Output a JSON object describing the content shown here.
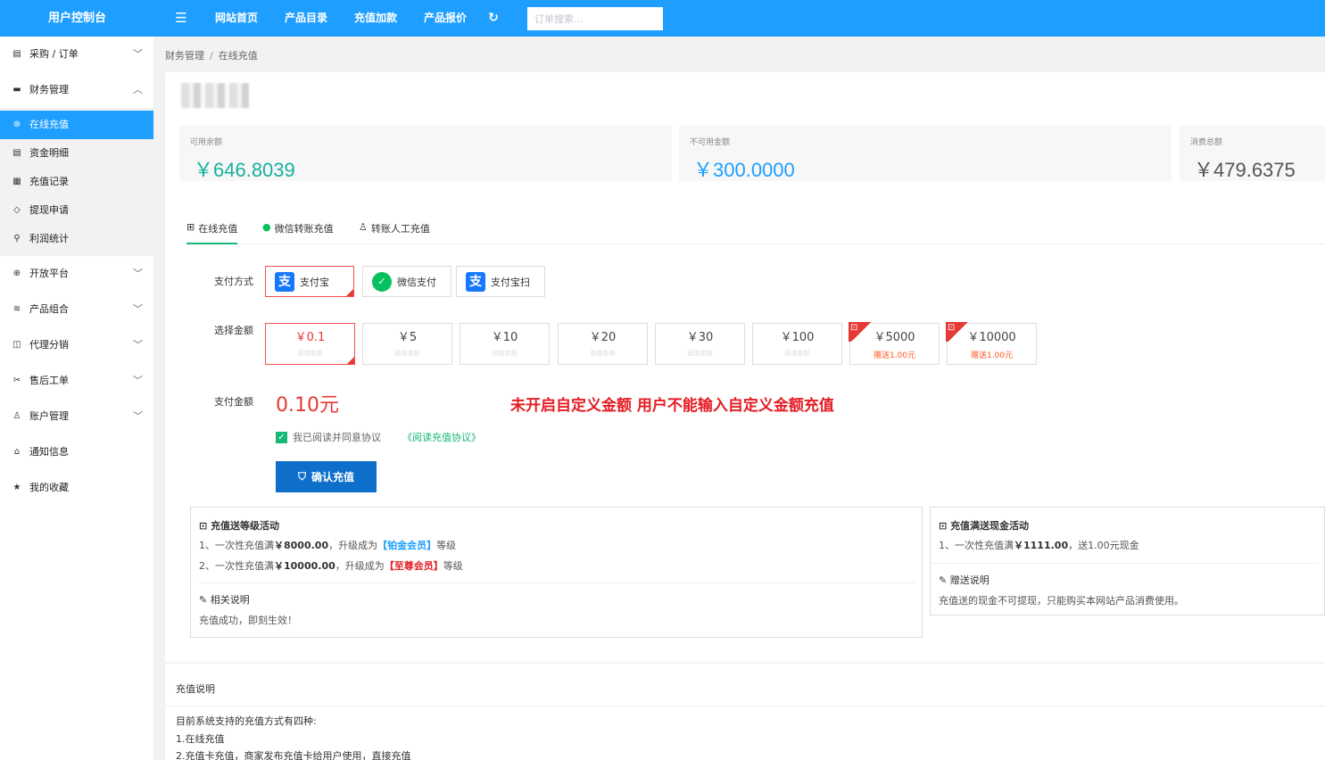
{
  "header": {
    "brand": "用户控制台",
    "menu_icon": "menu-icon",
    "nav": [
      "网站首页",
      "产品目录",
      "充值加款",
      "产品报价"
    ],
    "refresh_icon": "refresh-icon",
    "search_placeholder": "订单搜索..."
  },
  "sidebar": {
    "items": [
      {
        "label": "采购 / 订单",
        "icon": "order-icon",
        "chevron": "down"
      },
      {
        "label": "财务管理",
        "icon": "finance-icon",
        "chevron": "up"
      },
      {
        "label": "开放平台",
        "icon": "globe-icon",
        "chevron": "down"
      },
      {
        "label": "产品组合",
        "icon": "layers-icon",
        "chevron": "down"
      },
      {
        "label": "代理分销",
        "icon": "agent-icon",
        "chevron": "down"
      },
      {
        "label": "售后工单",
        "icon": "tools-icon",
        "chevron": "down"
      },
      {
        "label": "账户管理",
        "icon": "user-icon",
        "chevron": "down"
      },
      {
        "label": "通知信息",
        "icon": "home-icon",
        "chevron": ""
      },
      {
        "label": "我的收藏",
        "icon": "star-icon",
        "chevron": ""
      }
    ],
    "finance_sub": [
      {
        "label": "在线充值",
        "icon": "yen-icon",
        "active": true
      },
      {
        "label": "资金明细",
        "icon": "file-icon"
      },
      {
        "label": "充值记录",
        "icon": "calendar-icon"
      },
      {
        "label": "提现申请",
        "icon": "tag-icon"
      },
      {
        "label": "利润统计",
        "icon": "search-icon"
      }
    ]
  },
  "breadcrumb": {
    "parent": "财务管理",
    "sep": "/",
    "current": "在线充值"
  },
  "balance": {
    "available_label": "可用余额",
    "available_value": "￥646.8039",
    "unavailable_label": "不可用金额",
    "unavailable_value": "￥300.0000",
    "total_label": "消费总额",
    "total_value": "￥479.6375",
    "colors": {
      "available": "#16b0a0",
      "unavailable": "#1e9fff",
      "total": "#555555"
    }
  },
  "tabs": [
    {
      "label": "在线充值",
      "icon": "windows-icon"
    },
    {
      "label": "微信转账充值",
      "icon": "wechat-icon"
    },
    {
      "label": "转账人工充值",
      "icon": "person-icon"
    }
  ],
  "pay_method": {
    "label": "支付方式",
    "options": [
      {
        "label": "支付宝",
        "logo": "支"
      },
      {
        "label": "微信支付",
        "logo": "✓"
      },
      {
        "label": "支付宝扫",
        "logo": "支"
      }
    ]
  },
  "amount": {
    "label": "选择金额",
    "options": [
      {
        "value": "￥0.1",
        "sub": "面值金额"
      },
      {
        "value": "￥5",
        "sub": "面值金额"
      },
      {
        "value": "￥10",
        "sub": "面值金额"
      },
      {
        "value": "￥20",
        "sub": "面值金额"
      },
      {
        "value": "￥30",
        "sub": "面值金额"
      },
      {
        "value": "￥100",
        "sub": "面值金额"
      },
      {
        "value": "￥5000",
        "sub": "赠送1.00元"
      },
      {
        "value": "￥10000",
        "sub": "赠送1.00元"
      }
    ],
    "gift_icon": "gift-icon"
  },
  "payment": {
    "label": "支付金额",
    "value": "0.10元",
    "notice": "未开启自定义金额 用户不能输入自定义金额充值"
  },
  "agreement": {
    "text": "我已阅读并同意协议",
    "link": "《阅读充值协议》",
    "checked": true
  },
  "confirm_button": "确认充值",
  "promo_level": {
    "title": "充值送等级活动",
    "line1_pre": "1、一次性充值满",
    "line1_amount": "￥8000.00",
    "line1_mid": "，升级成为",
    "line1_level": "【铂金会员】",
    "line1_post": "等级",
    "line2_pre": "2、一次性充值满",
    "line2_amount": "￥10000.00",
    "line2_mid": "，升级成为",
    "line2_level": "【至尊会员】",
    "line2_post": "等级",
    "note_title": "相关说明",
    "note_text": "充值成功，即刻生效！"
  },
  "promo_cash": {
    "title": "充值满送现金活动",
    "line1_pre": "1、一次性充值满",
    "line1_amount": "￥1111.00",
    "line1_post": "，送1.00元现金",
    "note_title": "赠送说明",
    "note_text": "充值送的现金不可提现，只能购买本网站产品消费使用。"
  },
  "description": {
    "title": "充值说明",
    "lines": [
      "目前系统支持的充值方式有四种:",
      "1.在线充值",
      "2.充值卡充值，商家发布充值卡给用户使用，直接充值"
    ]
  }
}
